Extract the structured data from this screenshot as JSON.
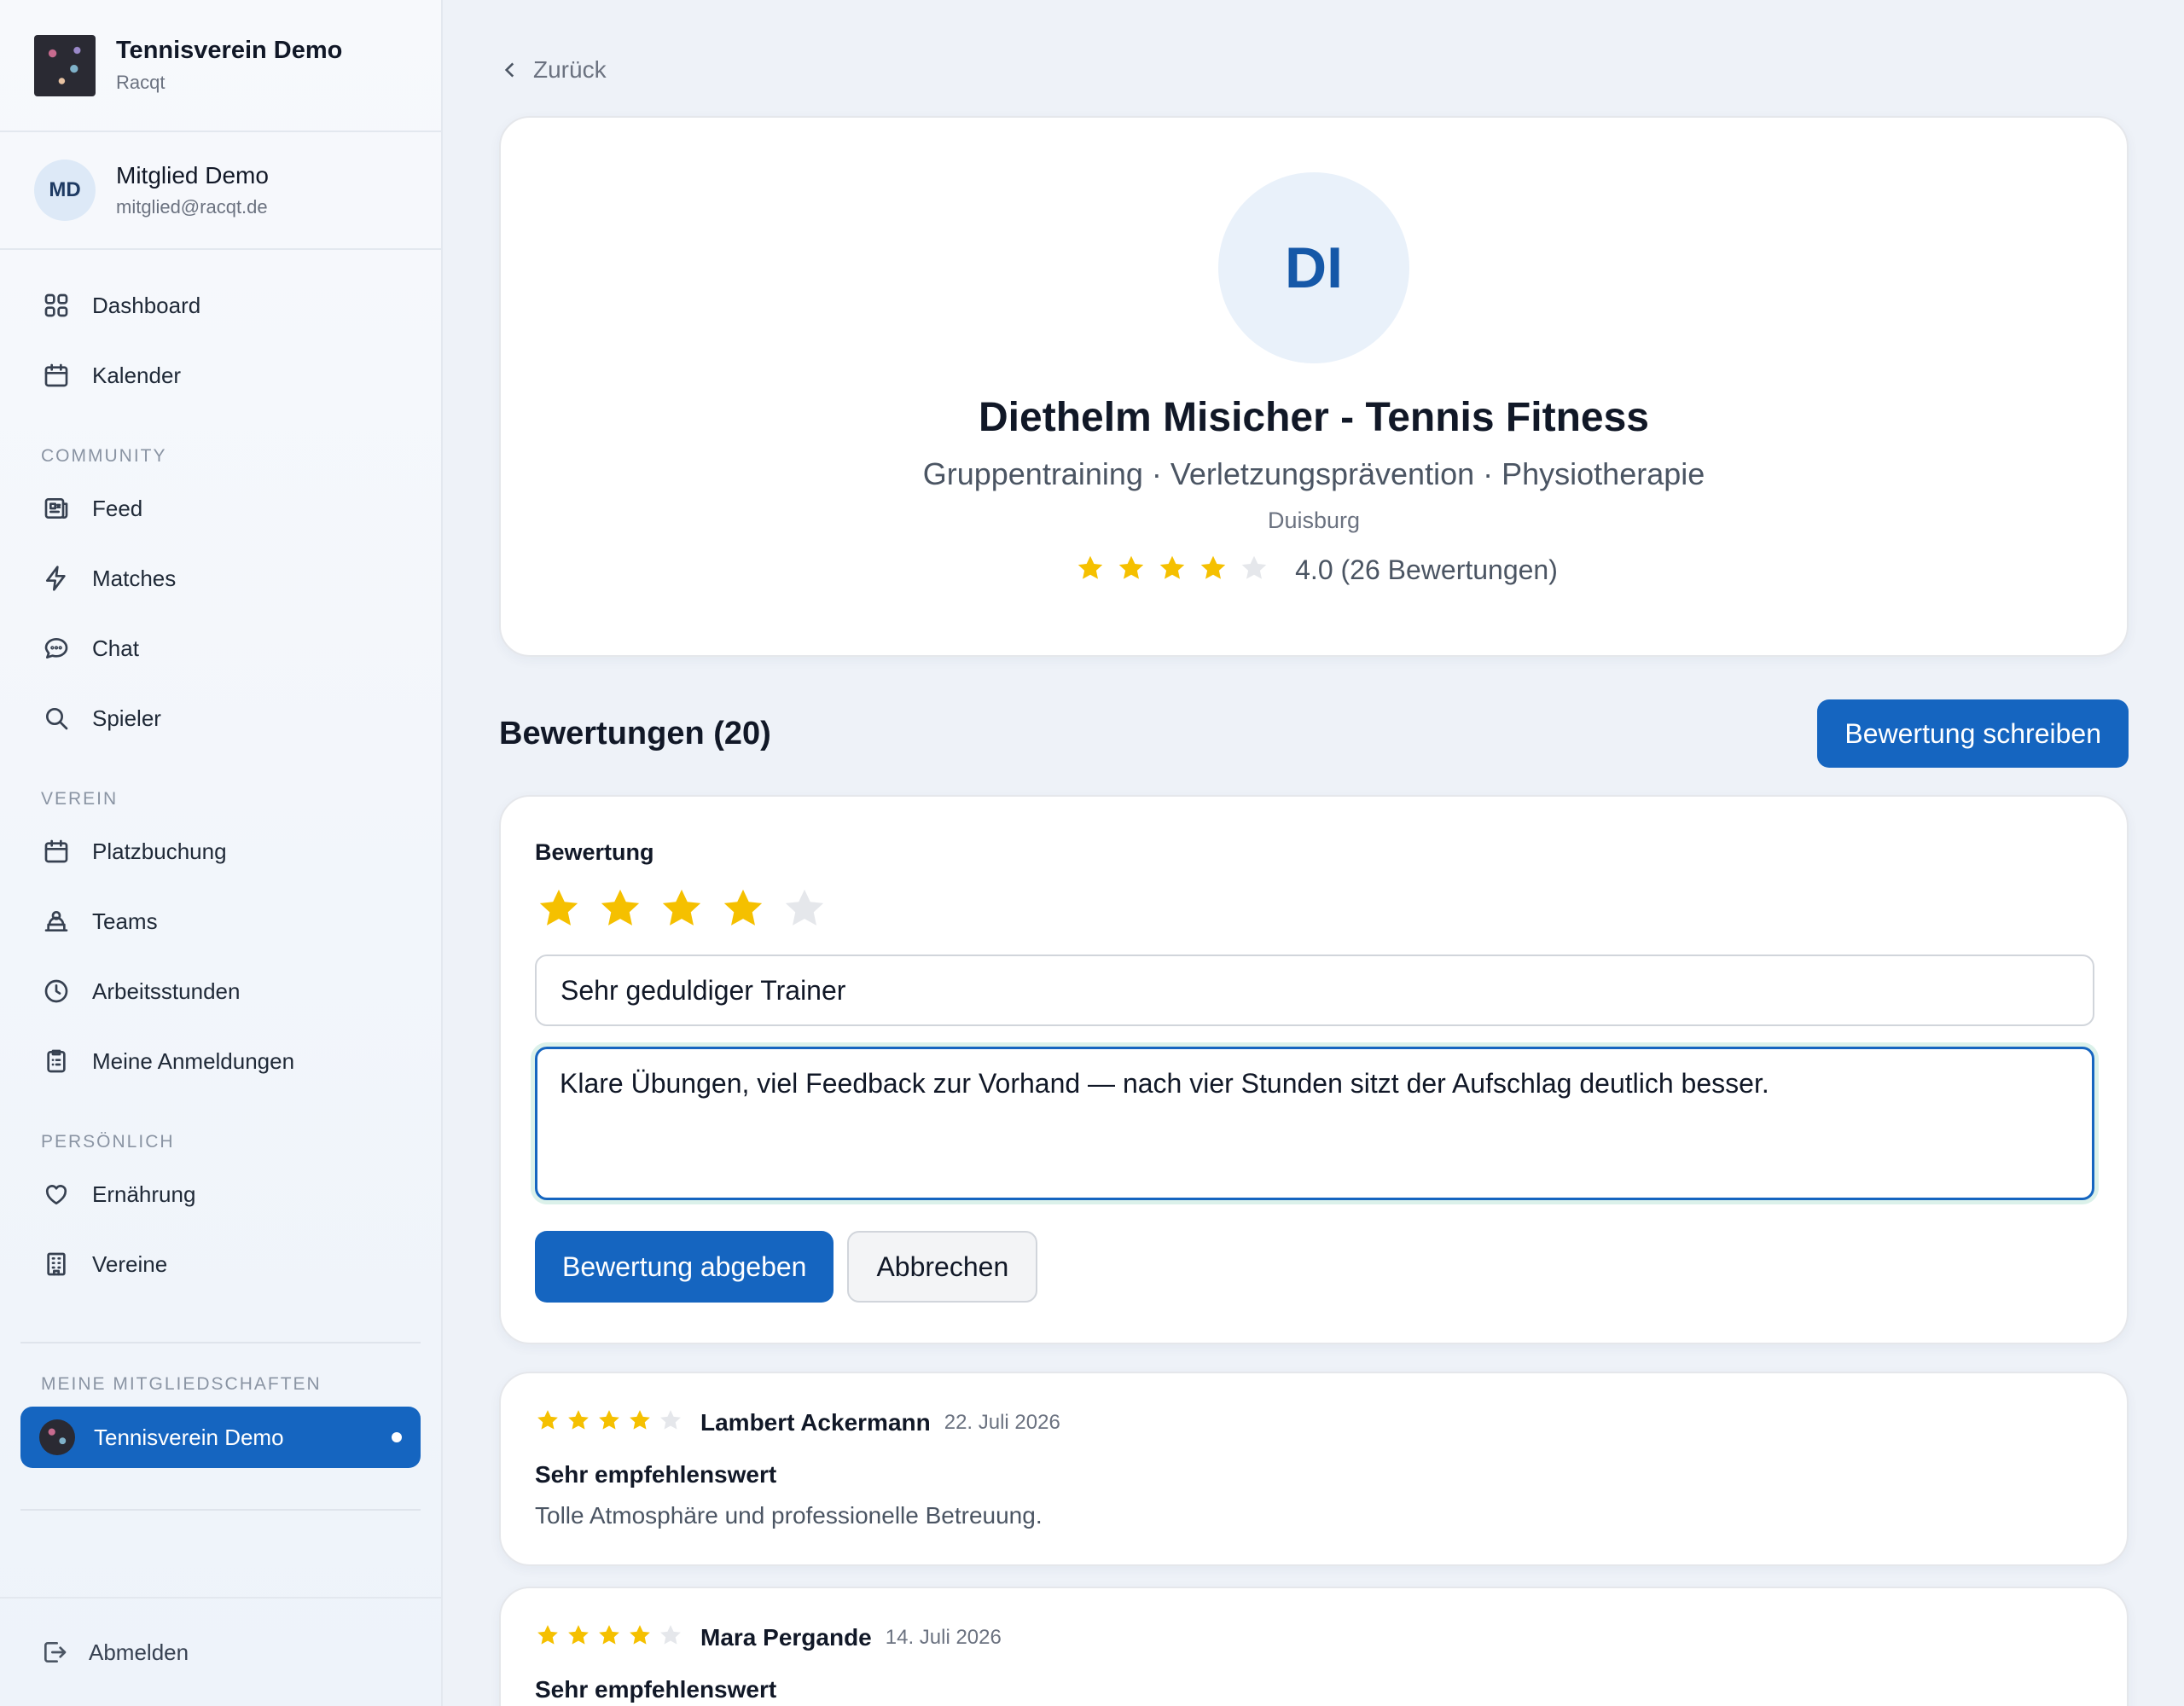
{
  "colors": {
    "accent": "#1565c0",
    "star": "#f5c000",
    "star_empty": "#e5e7eb"
  },
  "sidebar": {
    "brand": {
      "name": "Tennisverein Demo",
      "sub": "Racqt"
    },
    "user": {
      "initials": "MD",
      "name": "Mitglied Demo",
      "email": "mitglied@racqt.de"
    },
    "items_top": [
      {
        "label": "Dashboard",
        "icon": "grid-icon"
      },
      {
        "label": "Kalender",
        "icon": "calendar-icon"
      }
    ],
    "community_label": "COMMUNITY",
    "community": [
      {
        "label": "Feed",
        "icon": "newspaper-icon"
      },
      {
        "label": "Matches",
        "icon": "lightning-icon"
      },
      {
        "label": "Chat",
        "icon": "chat-bubble-icon"
      },
      {
        "label": "Spieler",
        "icon": "search-icon"
      }
    ],
    "verein_label": "VEREIN",
    "verein": [
      {
        "label": "Platzbuchung",
        "icon": "calendar-icon"
      },
      {
        "label": "Teams",
        "icon": "team-icon"
      },
      {
        "label": "Arbeitsstunden",
        "icon": "clock-icon"
      },
      {
        "label": "Meine Anmeldungen",
        "icon": "clipboard-icon"
      }
    ],
    "personal_label": "PERSÖNLICH",
    "personal": [
      {
        "label": "Ernährung",
        "icon": "heart-icon"
      },
      {
        "label": "Vereine",
        "icon": "building-icon"
      }
    ],
    "memberships_label": "MEINE MITGLIEDSCHAFTEN",
    "membership": "Tennisverein Demo",
    "logout": "Abmelden"
  },
  "back_label": "Zurück",
  "profile": {
    "initials": "DI",
    "name": "Diethelm Misicher - Tennis Fitness",
    "tags": "Gruppentraining · Verletzungsprävention · Physiotherapie",
    "city": "Duisburg",
    "rating": 4,
    "rating_text": "4.0 (26 Bewertungen)"
  },
  "reviews_header": {
    "title": "Bewertungen (20)",
    "write_button": "Bewertung schreiben"
  },
  "form": {
    "label": "Bewertung",
    "stars": 4,
    "title_value": "Sehr geduldiger Trainer",
    "body_value": "Klare Übungen, viel Feedback zur Vorhand — nach vier Stunden sitzt der Aufschlag deutlich besser.",
    "submit": "Bewertung abgeben",
    "cancel": "Abbrechen"
  },
  "reviews": [
    {
      "stars": 4,
      "author": "Lambert Ackermann",
      "date": "22. Juli 2026",
      "title": "Sehr empfehlenswert",
      "body": "Tolle Atmosphäre und professionelle Betreuung."
    },
    {
      "stars": 4,
      "author": "Mara Pergande",
      "date": "14. Juli 2026",
      "title": "Sehr empfehlenswert",
      "body": ""
    }
  ]
}
